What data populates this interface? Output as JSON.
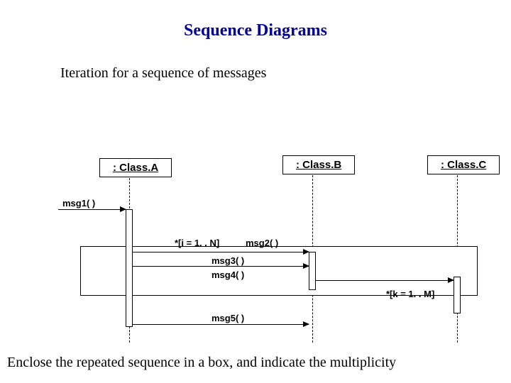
{
  "title": "Sequence Diagrams",
  "subtitle": "Iteration for a sequence of messages",
  "objects": {
    "a": ": Class.A",
    "b": ": Class.B",
    "c": ": Class.C"
  },
  "messages": {
    "m1": "msg1( )",
    "m2": "msg2( )",
    "m3": "msg3( )",
    "m4": "msg4( )",
    "m5": "msg5( )"
  },
  "multiplicity": {
    "i": "*[i = 1. . N]",
    "k": "*[k = 1. . M]"
  },
  "caption": "Enclose the repeated sequence in a box, and indicate the multiplicity"
}
